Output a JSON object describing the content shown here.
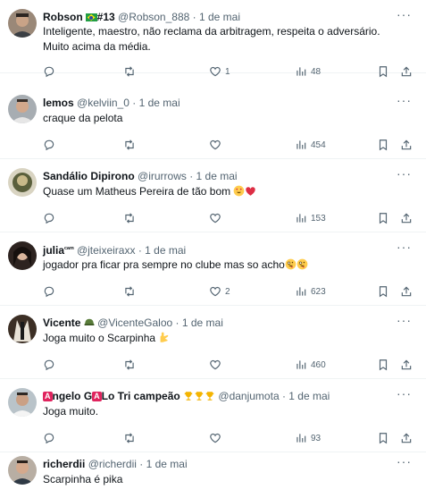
{
  "tweets": [
    {
      "name": "Robson",
      "badge": "#13",
      "handle": "@Robson_888",
      "time": "· 1 de mai",
      "text": "Inteligente, maestro, não reclama da arbitragem, respeita o adversário. Muito acima da média.",
      "likes": "1",
      "views": "48"
    },
    {
      "name": "lemos",
      "handle": "@kelviin_0",
      "time": "· 1 de mai",
      "text": "craque da pelota",
      "views": "454"
    },
    {
      "name": "Sandálio Dipirono",
      "handle": "@irurrows",
      "time": "· 1 de mai",
      "text": "Quase um Matheus Pereira de tão bom",
      "views": "153"
    },
    {
      "name": "julia",
      "name_suffix": "ᶜᵃᵐ",
      "handle": "@jteixeiraxx",
      "time": "· 1 de mai",
      "text": "jogador pra ficar pra sempre no clube mas so acho",
      "likes": "2",
      "views": "623"
    },
    {
      "name": "Vicente",
      "handle": "@VicenteGaloo",
      "time": "· 1 de mai",
      "text": "Joga muito o Scarpinha",
      "views": "460"
    },
    {
      "name_letter_1": "A",
      "name_part_1": "ngelo G",
      "name_letter_2": "A",
      "name_part_2": "Lo Tri campeão",
      "handle": "@danjumota",
      "time": "· 1 de mai",
      "text": "Joga muito.",
      "views": "93"
    },
    {
      "name": "richerdii",
      "handle": "@richerdii",
      "time": "· 1 de mai",
      "text": "Scarpinha é pika"
    }
  ],
  "icons": {
    "more": "more-icon",
    "reply": "reply-icon",
    "retweet": "retweet-icon",
    "like": "heart-icon",
    "views": "views-icon",
    "bookmark": "bookmark-icon",
    "share": "share-icon"
  },
  "colors": {
    "text": "#0f1419",
    "muted": "#536471",
    "divider": "#eff3f4"
  }
}
